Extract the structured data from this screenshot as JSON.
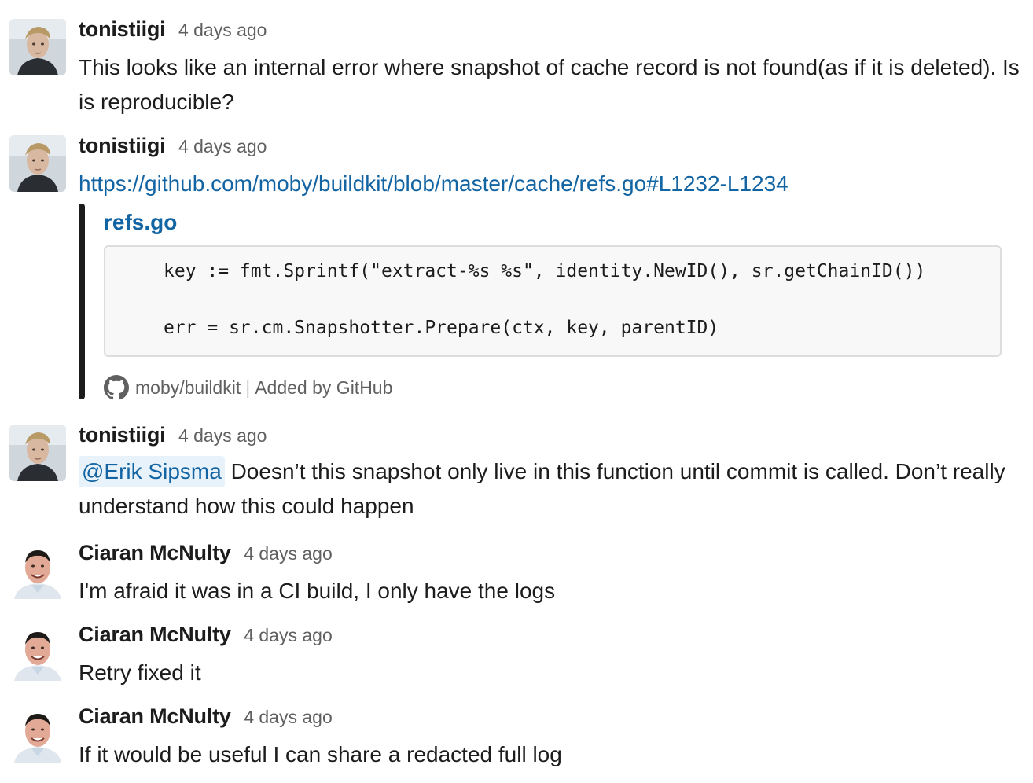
{
  "messages": [
    {
      "author": "tonistiigi",
      "time": "4 days ago",
      "text": "This looks like an internal error where snapshot of cache record is not found(as if it is deleted). Is is reproducible?"
    },
    {
      "author": "tonistiigi",
      "time": "4 days ago",
      "link": "https://github.com/moby/buildkit/blob/master/cache/refs.go#L1232-L1234",
      "unfurl": {
        "title": "refs.go",
        "code_lines": [
          "key := fmt.Sprintf(\"extract-%s %s\", identity.NewID(), sr.getChainID())",
          "err = sr.cm.Snapshotter.Prepare(ctx, key, parentID)"
        ],
        "repo": "moby/buildkit",
        "added_by": "Added by GitHub",
        "separator": "|"
      }
    },
    {
      "author": "tonistiigi",
      "time": "4 days ago",
      "mention": "@Erik Sipsma",
      "text": " Doesn’t this snapshot only live in this function until commit is called. Don’t really understand how this could happen"
    },
    {
      "author": "Ciaran McNulty",
      "time": "4 days ago",
      "text": "I'm afraid it was in a CI build, I only have the logs"
    },
    {
      "author": "Ciaran McNulty",
      "time": "4 days ago",
      "text": "Retry fixed it"
    },
    {
      "author": "Ciaran McNulty",
      "time": "4 days ago",
      "text": "If it would be useful I can share a redacted full log"
    }
  ],
  "colors": {
    "link": "#1264a3",
    "mention_bg": "#e8f2fa",
    "timestamp": "#616061",
    "text": "#1d1c1d"
  },
  "icons": {
    "repo_source": "github-icon"
  }
}
